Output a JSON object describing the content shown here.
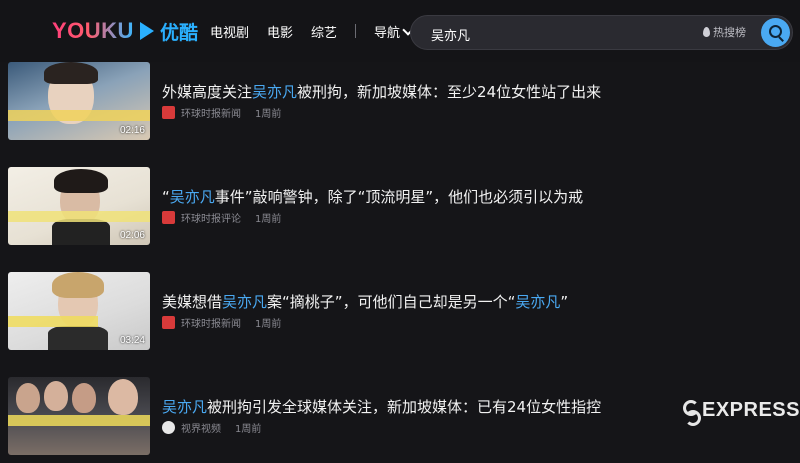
{
  "header": {
    "logo_en": "YOUKU",
    "logo_cn": "优酷",
    "nav": [
      "电视剧",
      "电影",
      "综艺"
    ],
    "nav_more": "导航"
  },
  "search": {
    "value": "吴亦凡",
    "hot_label": "热搜榜",
    "icon": "search-icon"
  },
  "videos": [
    {
      "title_pre": "外媒高度关注",
      "title_hl": "吴亦凡",
      "title_post": "被刑拘，新加坡媒体：至少24位女性站了出来",
      "title_hl2": "",
      "title_end": "",
      "source": "环球时报新闻",
      "time": "1周前",
      "duration": "02:16"
    },
    {
      "title_pre": "“",
      "title_hl": "吴亦凡",
      "title_post": "事件”敲响警钟，除了“顶流明星”，他们也必须引以为戒",
      "title_hl2": "",
      "title_end": "",
      "source": "环球时报评论",
      "time": "1周前",
      "duration": "02:06"
    },
    {
      "title_pre": "美媒想借",
      "title_hl": "吴亦凡",
      "title_post": "案“摘桃子”，可他们自己却是另一个“",
      "title_hl2": "吴亦凡",
      "title_end": "”",
      "source": "环球时报新闻",
      "time": "1周前",
      "duration": "03:24"
    },
    {
      "title_pre": "",
      "title_hl": "吴亦凡",
      "title_post": "被刑拘引发全球媒体关注，新加坡媒体：已有24位女性指控",
      "title_hl2": "",
      "title_end": "",
      "source": "视界视频",
      "time": "1周前",
      "duration": ""
    }
  ],
  "watermark": "EXPRESS",
  "colors": {
    "background": "#151518",
    "highlight": "#4aa9f2",
    "brand_pink": "#ff3f7a",
    "brand_blue": "#2ab0ff"
  }
}
